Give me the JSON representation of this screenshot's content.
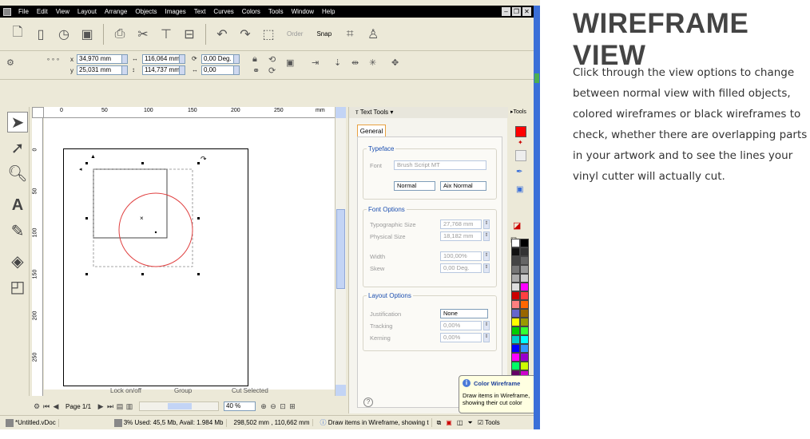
{
  "app": {
    "menu": [
      "File",
      "Edit",
      "View",
      "Layout",
      "Arrange",
      "Objects",
      "Images",
      "Text",
      "Curves",
      "Colors",
      "Tools",
      "Window",
      "Help"
    ],
    "toolbar": {
      "order_label": "Order",
      "snap_label": "Snap"
    },
    "position": {
      "x": "34,970 mm",
      "y": "25,031 mm",
      "w": "116,064 mm",
      "h": "114,737 mm",
      "rot": "0,00 Deg.",
      "offset": "0,00",
      "x_label": "x",
      "y_label": "y"
    },
    "ruler_h": [
      "0",
      "50",
      "100",
      "150",
      "200",
      "250",
      "mm"
    ],
    "ruler_v": [
      "0",
      "50",
      "100",
      "150",
      "200",
      "250"
    ],
    "canvas_status": [
      "Lock on/off",
      "Group",
      "Cut Selected"
    ],
    "page_label": "Page 1/1",
    "zoom": "40 %",
    "panel": {
      "header": "Text Tools",
      "tab": "General",
      "typeface": {
        "title": "Typeface",
        "font_label": "Font",
        "font_value": "Brush Script MT",
        "style1": "Normal",
        "style2": "Aix Normal"
      },
      "font_options": {
        "title": "Font Options",
        "typo_label": "Typographic Size",
        "typo_value": "27,768 mm",
        "phys_label": "Physical Size",
        "phys_value": "18,182 mm",
        "width_label": "Width",
        "width_value": "100,00%",
        "skew_label": "Skew",
        "skew_value": "0,00 Deg."
      },
      "layout_options": {
        "title": "Layout Options",
        "just_label": "Justification",
        "just_value": "None",
        "track_label": "Tracking",
        "track_value": "0,00%",
        "kern_label": "Kerning",
        "kern_value": "0,00%"
      }
    },
    "tools_header": "Tools",
    "tooltip": {
      "title": "Color Wireframe",
      "body": "Draw items in Wireframe, showing their cut color"
    },
    "statusbar": {
      "file": "*Untitled.vDoc",
      "memory": "3%  Used: 45,5 Mb, Avail: 1.984 Mb",
      "coords": "298,502 mm , 110,662 mm",
      "hint": "Draw items in Wireframe, showing t",
      "tools": "Tools"
    }
  },
  "article": {
    "title": "WIREFRAME VIEW",
    "text": "Click through the view options to change between normal view with filled objects, colored wireframes or black wireframes to check, whether there are overlapping parts in your artwork and to see the lines your vinyl cutter will actually cut."
  },
  "colors": {
    "accent_red": "#ff0000",
    "wireframe_red": "#e04040",
    "blue_bar": "#3a6fd8"
  },
  "palette": [
    "#ffffff",
    "#000000",
    "#111111",
    "#333333",
    "#444444",
    "#666666",
    "#777777",
    "#999999",
    "#aaaaaa",
    "#cccccc",
    "#dddddd",
    "#ff00ff",
    "#cc0000",
    "#ff4040",
    "#ff8080",
    "#ff6600",
    "#6666cc",
    "#996600",
    "#ffff00",
    "#999900",
    "#00cc00",
    "#33ff33",
    "#00cccc",
    "#00ffff",
    "#0000ff",
    "#3399ff",
    "#ff00ff",
    "#9900cc",
    "#00ff66",
    "#ccff00",
    "#660066",
    "#cc00cc"
  ]
}
